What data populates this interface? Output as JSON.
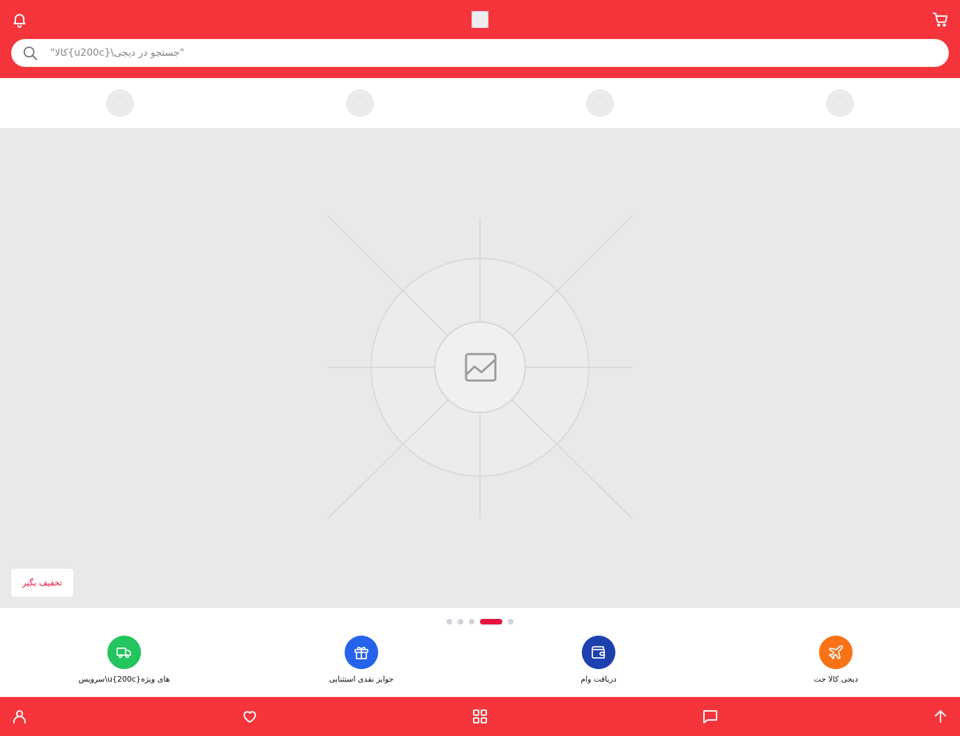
{
  "colors": {
    "brand_red": "#f5353b",
    "accent_red": "#e6123d",
    "placeholder_gray": "#e9e9e9",
    "service_green": "#22c55e",
    "service_blue": "#2563eb",
    "service_navy": "#1e40af",
    "service_orange": "#f97316"
  },
  "header": {
    "bell_icon": "bell-icon",
    "cart_icon": "cart-icon",
    "logo": "logo-placeholder"
  },
  "search": {
    "placeholder": "\"کالا{u200c}\\جستجو در دیجی\"",
    "icon": "search-icon"
  },
  "stories": {
    "count": 4
  },
  "hero": {
    "image": "image-placeholder-icon",
    "discount_button_label": "تخفیف بگیر"
  },
  "pagination": {
    "total": 5,
    "active_index": 3
  },
  "services": [
    {
      "label": "سرویس\\u{200c}های ویژه",
      "icon": "truck-icon",
      "color": "#22c55e"
    },
    {
      "label": "جوایز نقدی استثنایی",
      "icon": "gift-icon",
      "color": "#2563eb"
    },
    {
      "label": "دریافت وام",
      "icon": "wallet-icon",
      "color": "#1e40af"
    },
    {
      "label": "دیجی کالا جت",
      "icon": "plane-icon",
      "color": "#f97316"
    }
  ],
  "bottom_nav": [
    {
      "icon": "user-icon"
    },
    {
      "icon": "heart-icon"
    },
    {
      "icon": "grid-icon"
    },
    {
      "icon": "chat-icon"
    },
    {
      "icon": "arrow-up-icon"
    }
  ]
}
